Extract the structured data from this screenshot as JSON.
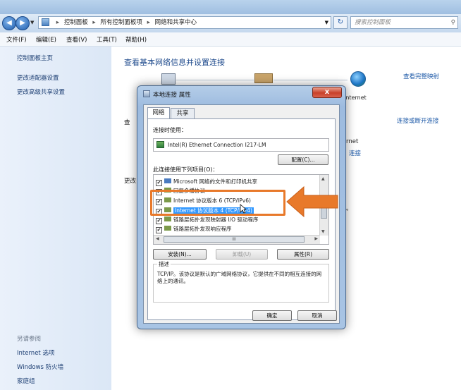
{
  "address": {
    "crumbs": [
      "控制面板",
      "所有控制面板项",
      "网络和共享中心"
    ],
    "search_placeholder": "搜索控制面板"
  },
  "menubar": [
    "文件(F)",
    "编辑(E)",
    "查看(V)",
    "工具(T)",
    "帮助(H)"
  ],
  "leftpane": {
    "links": [
      "控制面板主页",
      "更改适配器设置",
      "更改高级共享设置"
    ],
    "see_also": "另请参阅",
    "see_also_links": [
      "Internet 选项",
      "Windows 防火墙",
      "家庭组"
    ]
  },
  "main": {
    "title": "查看基本网络信息并设置连接",
    "view_full_map": "查看完整映射",
    "internet": "Internet",
    "connect_disconnect": "连接或断开连接",
    "partial_view": "查",
    "partial_change": "更改",
    "partial_net": "rnet",
    "partial_conn": "连接",
    "partial_dot": "。"
  },
  "dialog": {
    "title": "本地连接 属性",
    "close": "x",
    "tabs": [
      "网络",
      "共享"
    ],
    "connect_using_label": "连接时使用：",
    "adapter": "Intel(R) Ethernet Connection I217-LM",
    "configure_button": "配置(C)...",
    "items_label": "此连接使用下列项目(O)：",
    "items": [
      {
        "checked": "✔",
        "label": "Microsoft 网络的文件和打印机共享"
      },
      {
        "checked": "✔",
        "label": "回复多播协议"
      },
      {
        "checked": "✔",
        "label": "Internet 协议版本 6 (TCP/IPv6)"
      },
      {
        "checked": "✔",
        "label": "Internet 协议版本 4 (TCP/IPv4)"
      },
      {
        "checked": "✔",
        "label": "链路层拓扑发现映射器 I/O 驱动程序"
      },
      {
        "checked": "✔",
        "label": "链路层拓扑发现响应程序"
      }
    ],
    "hscroll_glyph": "III",
    "install_button": "安装(N)...",
    "uninstall_button": "卸载(U)",
    "properties_button": "属性(R)",
    "description_legend": "描述",
    "description_text": "TCP/IP。该协议是默认的广域网络协议，它提供在不同的相互连接的网络上的通讯。",
    "ok_button": "确定",
    "cancel_button": "取消"
  },
  "watermark": {
    "logo": "Bai",
    "sub": "jingyan"
  },
  "colors": {
    "highlight": "#e8792a",
    "selection": "#3399ff",
    "link": "#1e5aa8"
  }
}
